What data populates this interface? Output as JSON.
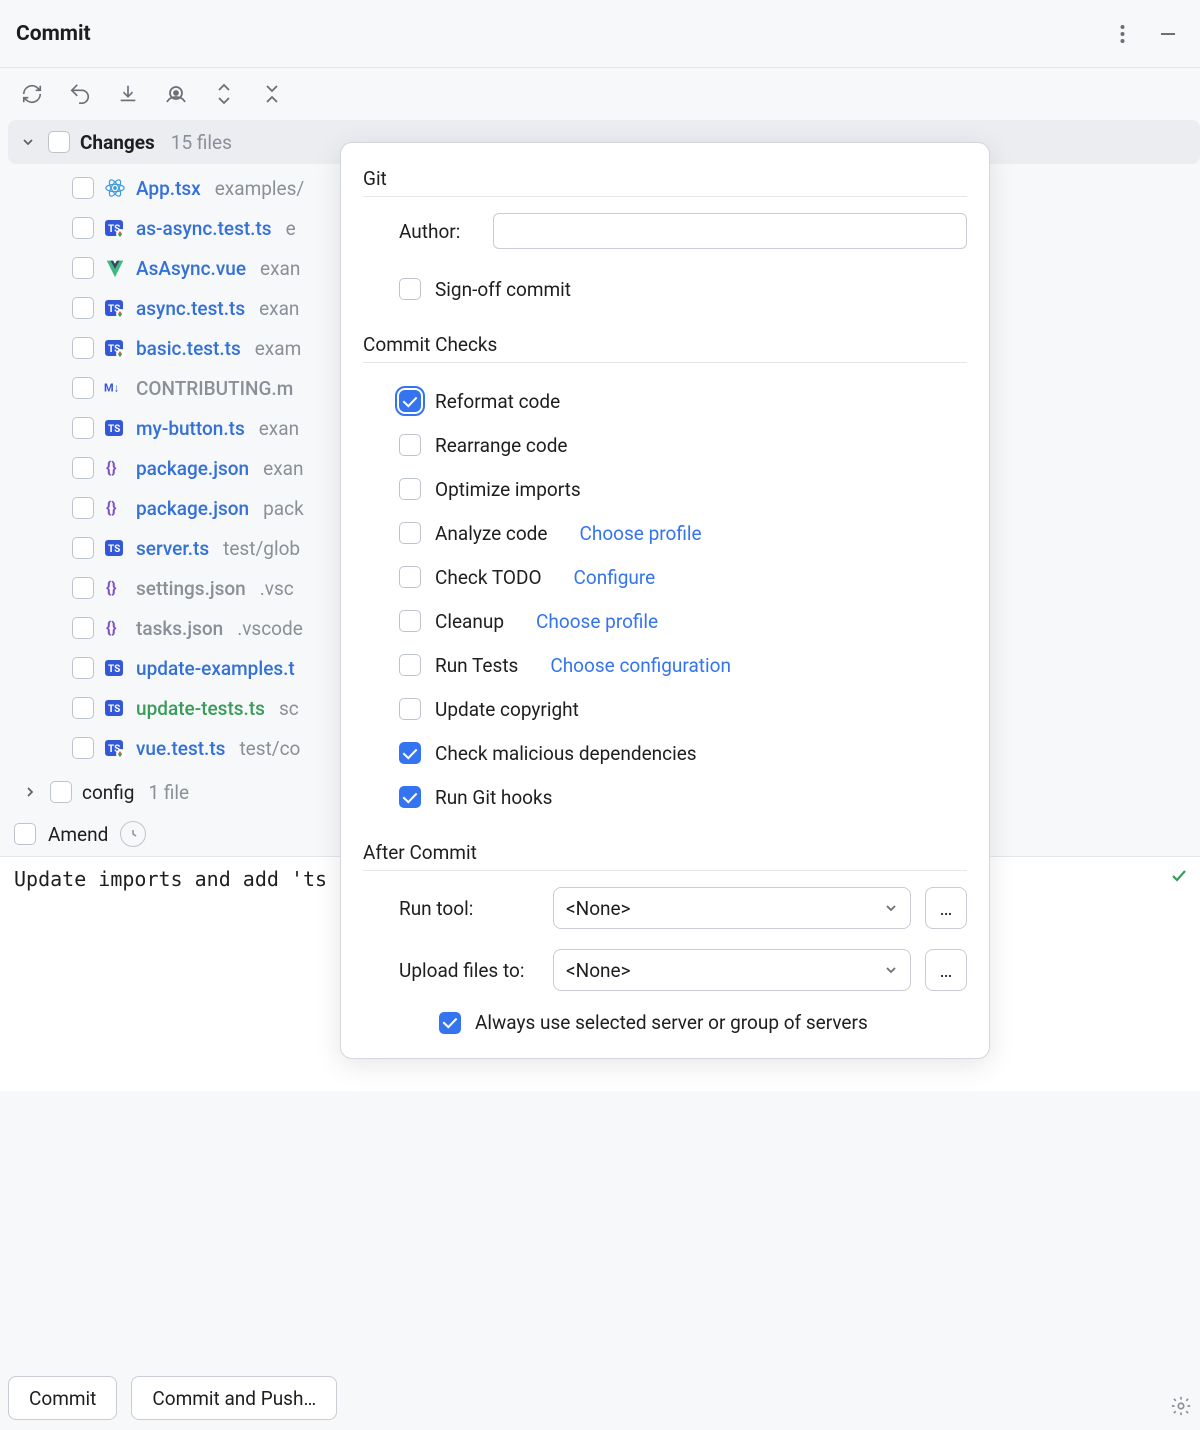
{
  "header": {
    "title": "Commit"
  },
  "changes": {
    "label": "Changes",
    "count": "15 files",
    "files": [
      {
        "icon": "react",
        "name": "App.tsx",
        "color": "blue",
        "path": "examples/"
      },
      {
        "icon": "ts-mod",
        "name": "as-async.test.ts",
        "color": "blue",
        "path": "e"
      },
      {
        "icon": "vue",
        "name": "AsAsync.vue",
        "color": "blue",
        "path": "exan"
      },
      {
        "icon": "ts-mod",
        "name": "async.test.ts",
        "color": "blue",
        "path": "exan"
      },
      {
        "icon": "ts-mod",
        "name": "basic.test.ts",
        "color": "blue",
        "path": "exam"
      },
      {
        "icon": "md",
        "name": "CONTRIBUTING.m",
        "color": "gray",
        "path": ""
      },
      {
        "icon": "ts",
        "name": "my-button.ts",
        "color": "blue",
        "path": "exan"
      },
      {
        "icon": "json",
        "name": "package.json",
        "color": "blue",
        "path": "exan"
      },
      {
        "icon": "json",
        "name": "package.json",
        "color": "blue",
        "path": "pack"
      },
      {
        "icon": "ts",
        "name": "server.ts",
        "color": "blue",
        "path": "test/glob"
      },
      {
        "icon": "json",
        "name": "settings.json",
        "color": "gray",
        "path": ".vsc"
      },
      {
        "icon": "json",
        "name": "tasks.json",
        "color": "gray",
        "path": ".vscode"
      },
      {
        "icon": "ts",
        "name": "update-examples.t",
        "color": "blue",
        "path": ""
      },
      {
        "icon": "ts",
        "name": "update-tests.ts",
        "color": "green",
        "path": "sc"
      },
      {
        "icon": "ts-mod",
        "name": "vue.test.ts",
        "color": "blue",
        "path": "test/co"
      }
    ]
  },
  "config_section": {
    "label": "config",
    "count": "1 file"
  },
  "amend": {
    "label": "Amend"
  },
  "commit_message": "Update imports and add 'ts",
  "buttons": {
    "commit": "Commit",
    "commit_push": "Commit and Push…"
  },
  "popup": {
    "git_title": "Git",
    "author_label": "Author:",
    "author_value": "",
    "signoff": {
      "label": "Sign-off commit",
      "checked": false
    },
    "checks_title": "Commit Checks",
    "checks": [
      {
        "label": "Reformat code",
        "checked": true,
        "focus": true
      },
      {
        "label": "Rearrange code",
        "checked": false
      },
      {
        "label": "Optimize imports",
        "checked": false
      },
      {
        "label": "Analyze code",
        "checked": false,
        "link": "Choose profile"
      },
      {
        "label": "Check TODO",
        "checked": false,
        "link": "Configure"
      },
      {
        "label": "Cleanup",
        "checked": false,
        "link": "Choose profile"
      },
      {
        "label": "Run Tests",
        "checked": false,
        "link": "Choose configuration"
      },
      {
        "label": "Update copyright",
        "checked": false
      },
      {
        "label": "Check malicious dependencies",
        "checked": true
      },
      {
        "label": "Run Git hooks",
        "checked": true
      }
    ],
    "after_title": "After Commit",
    "run_tool_label": "Run tool:",
    "run_tool_value": "<None>",
    "upload_label": "Upload files to:",
    "upload_value": "<None>",
    "always": {
      "label": "Always use selected server or group of servers",
      "checked": true
    }
  }
}
